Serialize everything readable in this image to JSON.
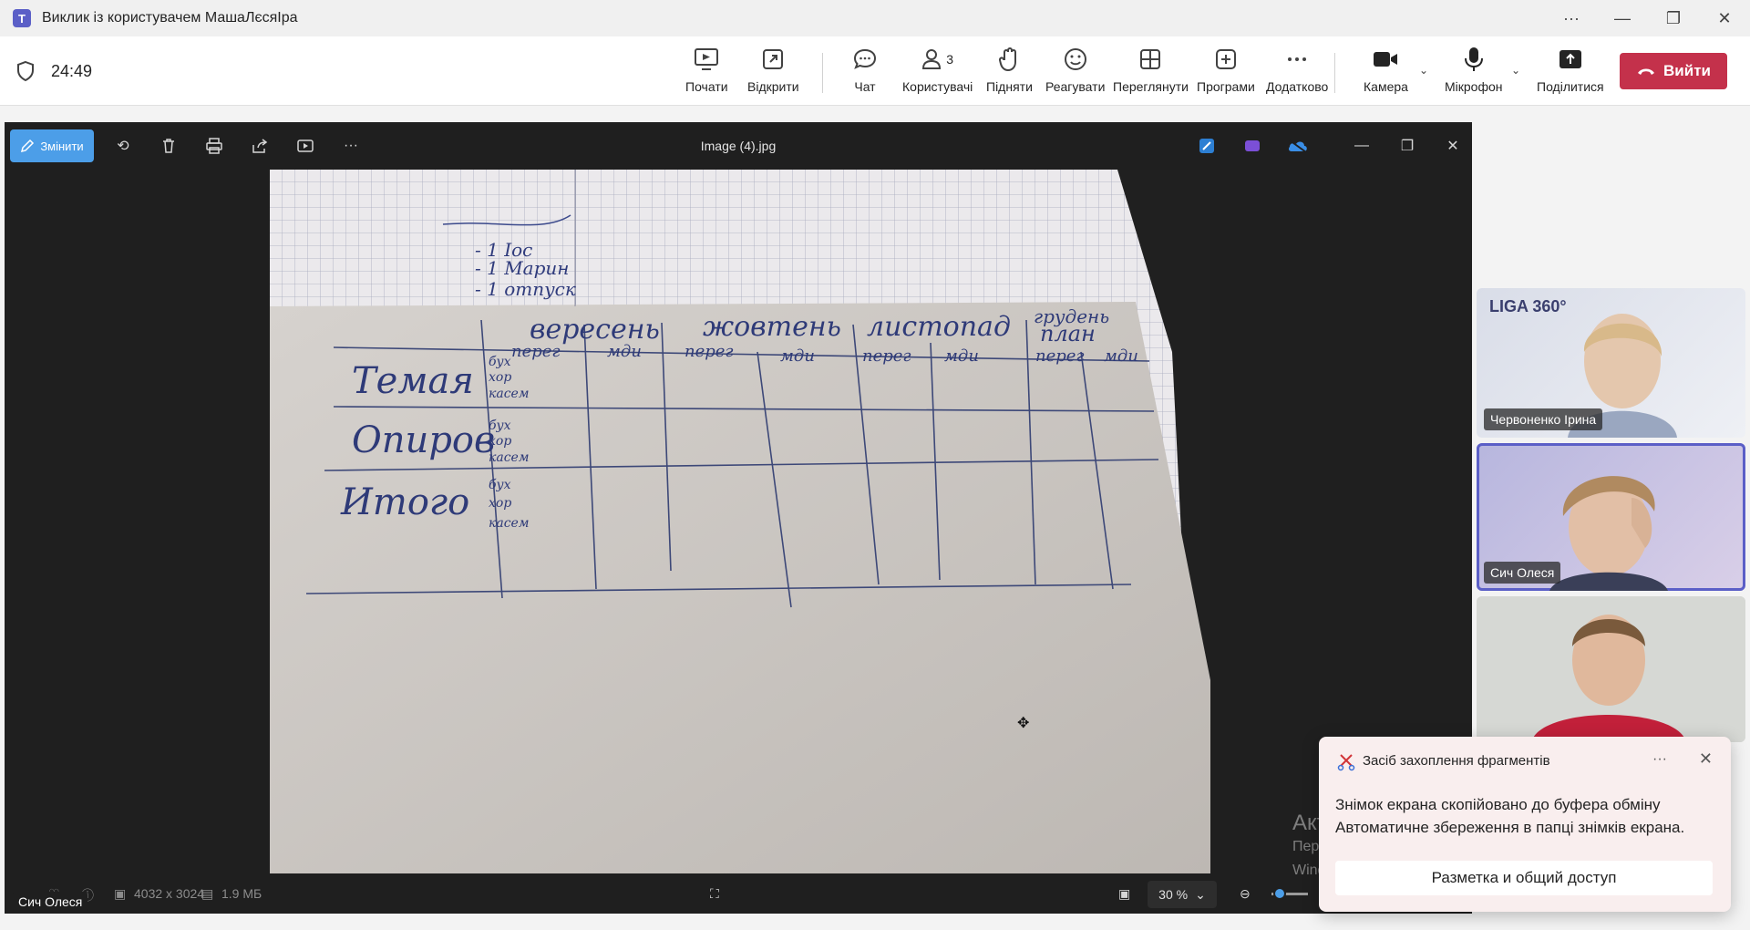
{
  "window": {
    "title": "Виклик із користувачем МашаЛєсяІра"
  },
  "meeting": {
    "timer": "24:49",
    "actions": [
      {
        "id": "start",
        "label": "Почати",
        "icon": "record-icon"
      },
      {
        "id": "open",
        "label": "Відкрити",
        "icon": "popout-icon"
      },
      {
        "id": "chat",
        "label": "Чат",
        "icon": "chat-icon"
      },
      {
        "id": "people",
        "label": "Користувачі",
        "icon": "people-icon",
        "badge": "3"
      },
      {
        "id": "raise",
        "label": "Підняти",
        "icon": "hand-icon"
      },
      {
        "id": "react",
        "label": "Реагувати",
        "icon": "smile-icon"
      },
      {
        "id": "view",
        "label": "Переглянути",
        "icon": "grid-icon"
      },
      {
        "id": "apps",
        "label": "Програми",
        "icon": "plus-box-icon"
      },
      {
        "id": "more",
        "label": "Додатково",
        "icon": "more-icon"
      },
      {
        "id": "camera",
        "label": "Камера",
        "icon": "camera-icon"
      },
      {
        "id": "mic",
        "label": "Мікрофон",
        "icon": "mic-icon"
      },
      {
        "id": "share",
        "label": "Поділитися",
        "icon": "share-icon"
      }
    ],
    "leave_label": "Вийти"
  },
  "viewer": {
    "edit_label": "Змінити",
    "filename": "Image (4).jpg",
    "dimensions": "4032 x 3024",
    "filesize": "1.9 МБ",
    "zoom": "30 %",
    "accent": "#4c9ee8"
  },
  "photo": {
    "notes_top": [
      "- 1 Іос",
      "- 1 Марин",
      "- 1 отпуск"
    ],
    "months": [
      "вересень",
      "жовтень",
      "листопад",
      "грудень"
    ],
    "month_sub": "план",
    "subcols": [
      "перег",
      "мди"
    ],
    "rows": [
      "Темая",
      "Опиров",
      "Итого"
    ],
    "row_sub": [
      "бух",
      "хор",
      "касем"
    ]
  },
  "participants": [
    {
      "name": "Червоненко Ірина",
      "logo": "LIGA 360°"
    },
    {
      "name": "Сич Олеся"
    },
    {
      "name": ""
    }
  ],
  "self_label": "Сич Олеся",
  "notification": {
    "app": "Засіб захоплення фрагментів",
    "line1": "Знімок екрана скопійовано до буфера обміну",
    "line2": "Автоматичне збереження в папці знімків екрана.",
    "action": "Разметка и общий доступ"
  },
  "watermark": {
    "line1": "Активація Windows",
    "line2": "Перейдіть до розділу \"Настройки\", щоб активувати",
    "line3": "Windows."
  }
}
